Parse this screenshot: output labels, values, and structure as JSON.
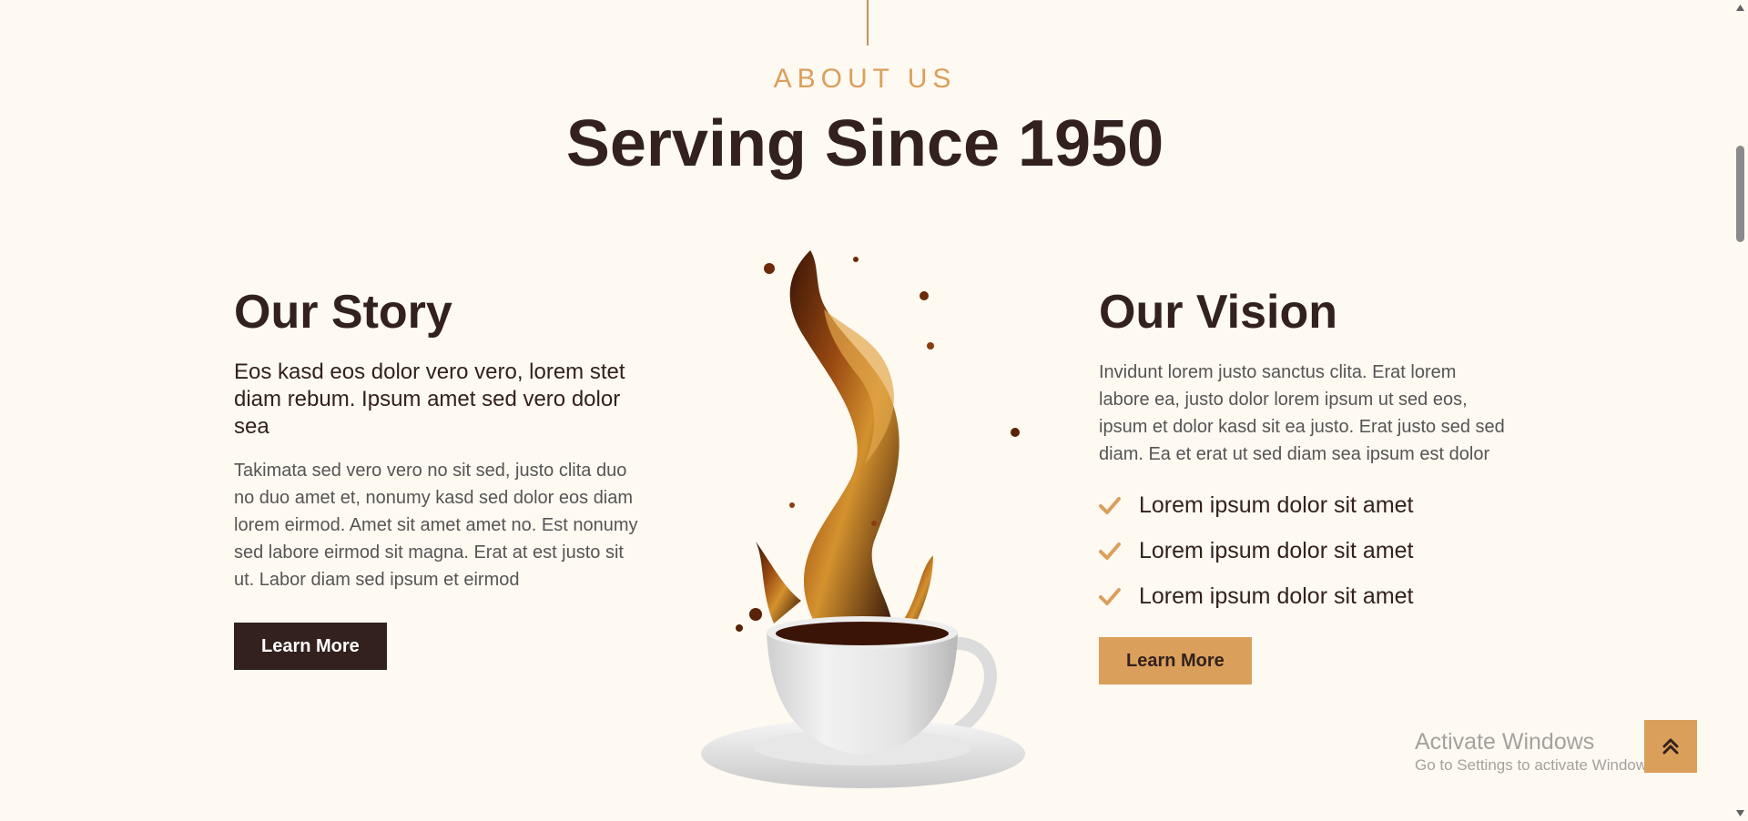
{
  "header": {
    "eyebrow": "ABOUT US",
    "title": "Serving Since 1950"
  },
  "story": {
    "heading": "Our Story",
    "lead": "Eos kasd eos dolor vero vero, lorem stet diam rebum. Ipsum amet sed vero dolor sea",
    "body": "Takimata sed vero vero no sit sed, justo clita duo no duo amet et, nonumy kasd sed dolor eos diam lorem eirmod. Amet sit amet amet no. Est nonumy sed labore eirmod sit magna. Erat at est justo sit ut. Labor diam sed ipsum et eirmod",
    "button_label": "Learn More"
  },
  "vision": {
    "heading": "Our Vision",
    "body": "Invidunt lorem justo sanctus clita. Erat lorem labore ea, justo dolor lorem ipsum ut sed eos, ipsum et dolor kasd sit ea justo. Erat justo sed sed diam. Ea et erat ut sed diam sea ipsum est dolor",
    "checklist": [
      "Lorem ipsum dolor sit amet",
      "Lorem ipsum dolor sit amet",
      "Lorem ipsum dolor sit amet"
    ],
    "button_label": "Learn More"
  },
  "image": {
    "icon": "coffee-splash-cup-image"
  },
  "watermark": {
    "title": "Activate Windows",
    "subtitle": "Go to Settings to activate Windows."
  },
  "back_to_top": {
    "icon": "double-chevron-up-icon"
  },
  "colors": {
    "background": "#fef9f1",
    "accent": "#da9f5b",
    "dark": "#33211d",
    "text": "#555555"
  }
}
